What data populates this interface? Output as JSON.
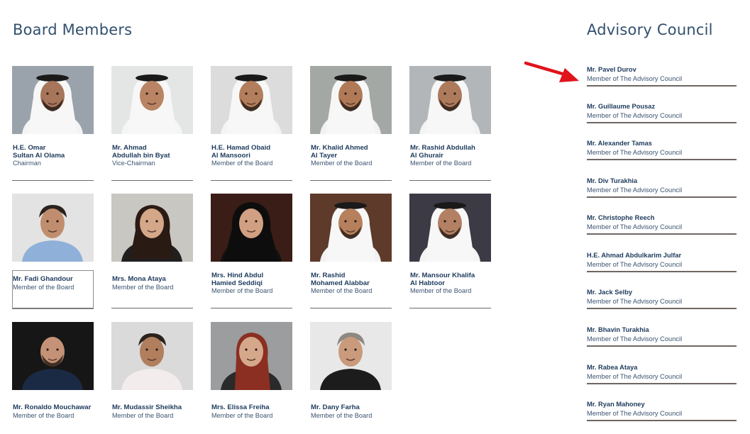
{
  "board": {
    "title": "Board Members",
    "members": [
      {
        "name1": "H.E. Omar",
        "name2": "Sultan Al Olama",
        "role": "Chairman",
        "photo": {
          "bg": "#9aa3ac",
          "skin": "#a6755a",
          "garment": "#f4f4f4",
          "headwear": "ghutra",
          "beard": true
        }
      },
      {
        "name1": "Mr. Ahmad",
        "name2": "Abdullah bin Byat",
        "role": "Vice-Chairman",
        "photo": {
          "bg": "#e4e6e5",
          "skin": "#b98463",
          "garment": "#f5f5f5",
          "headwear": "ghutra",
          "beard": false
        }
      },
      {
        "name1": "H.E. Hamad Obaid",
        "name2": "Al Mansoori",
        "role": "Member of the Board",
        "photo": {
          "bg": "#dcdcdc",
          "skin": "#b37e5c",
          "garment": "#f4f4f4",
          "headwear": "ghutra",
          "beard": true
        }
      },
      {
        "name1": "Mr. Khalid Ahmed",
        "name2": "Al Tayer",
        "role": "Member of the Board",
        "photo": {
          "bg": "#a4a8a5",
          "skin": "#b07a57",
          "garment": "#f2f2f2",
          "headwear": "ghutra",
          "beard": true
        }
      },
      {
        "name1": "Mr. Rashid Abdullah",
        "name2": "Al Ghurair",
        "role": "Member of the Board",
        "photo": {
          "bg": "#b2b6b8",
          "skin": "#ad7a5c",
          "garment": "#f3f3f3",
          "headwear": "ghutra",
          "beard": true
        }
      },
      {
        "name1": "Mr. Fadi Ghandour",
        "name2": "",
        "role": "Member of the Board",
        "photo": {
          "bg": "#e3e3e3",
          "skin": "#c08e6e",
          "garment": "#8fb0d8",
          "headwear": "hair",
          "beard": false
        }
      },
      {
        "name1": "Mrs. Mona Ataya",
        "name2": "",
        "role": "Member of the Board",
        "photo": {
          "bg": "#c9c7c1",
          "skin": "#d4a789",
          "garment": "#1f1f1f",
          "headwear": "longhair",
          "beard": false
        }
      },
      {
        "name1": "Mrs. Hind Abdul",
        "name2": "Hamied Seddiqi",
        "role": "Member of the Board",
        "photo": {
          "bg": "#3a1d16",
          "skin": "#d1a082",
          "garment": "#111111",
          "headwear": "hijab",
          "beard": false
        }
      },
      {
        "name1": "Mr. Rashid",
        "name2": "Mohamed Alabbar",
        "role": "Member of the Board",
        "photo": {
          "bg": "#5e3a2a",
          "skin": "#b6805c",
          "garment": "#f2f2f2",
          "headwear": "ghutra",
          "beard": true
        }
      },
      {
        "name1": "Mr. Mansour Khalifa",
        "name2": "Al Habtoor",
        "role": "Member of the Board",
        "photo": {
          "bg": "#3c3a44",
          "skin": "#b38063",
          "garment": "#f4f4f4",
          "headwear": "ghutra",
          "beard": true
        }
      },
      {
        "name1": "Mr. Ronaldo Mouchawar",
        "name2": "",
        "role": "Member of the Board",
        "photo": {
          "bg": "#161616",
          "skin": "#c49276",
          "garment": "#1b2a44",
          "headwear": "bald",
          "beard": true
        }
      },
      {
        "name1": "Mr. Mudassir Sheikha",
        "name2": "",
        "role": "Member of the Board",
        "photo": {
          "bg": "#dadada",
          "skin": "#b17e5e",
          "garment": "#f3ecec",
          "headwear": "hair",
          "beard": false
        }
      },
      {
        "name1": "Mrs. Elissa Freiha",
        "name2": "",
        "role": "Member of the Board",
        "photo": {
          "bg": "#9c9d9e",
          "skin": "#d5a88c",
          "garment": "#2a2a2a",
          "headwear": "redhair",
          "beard": false
        }
      },
      {
        "name1": "Mr. Dany Farha",
        "name2": "",
        "role": "Member of the Board",
        "photo": {
          "bg": "#e8e8e8",
          "skin": "#c99a7c",
          "garment": "#1c1c1c",
          "headwear": "greyhair",
          "beard": false
        }
      }
    ]
  },
  "advisory": {
    "title": "Advisory Council",
    "members": [
      {
        "name": "Mr. Pavel Durov",
        "role": "Member of The Advisory Council"
      },
      {
        "name": "Mr. Guillaume Pousaz",
        "role": "Member of The Advisory Council"
      },
      {
        "name": "Mr. Alexander Tamas",
        "role": "Member of The Advisory Council"
      },
      {
        "name": "Mr. Div Turakhia",
        "role": "Member of The Advisory Council"
      },
      {
        "name": "Mr. Christophe Reech",
        "role": "Member of The Advisory Council"
      },
      {
        "name": "H.E. Ahmad Abdulkarim Julfar",
        "role": "Member of The Advisory Council"
      },
      {
        "name": "Mr. Jack Selby",
        "role": "Member of The Advisory Council"
      },
      {
        "name": "Mr. Bhavin Turakhia",
        "role": "Member of The Advisory Council"
      },
      {
        "name": "Mr. Rabea Ataya",
        "role": "Member of The Advisory Council"
      },
      {
        "name": "Mr. Ryan Mahoney",
        "role": "Member of The Advisory Council"
      }
    ]
  },
  "colors": {
    "title": "#33506e",
    "name": "#1d3a5c",
    "role": "#3b5470",
    "arrow": "#e0141c"
  }
}
